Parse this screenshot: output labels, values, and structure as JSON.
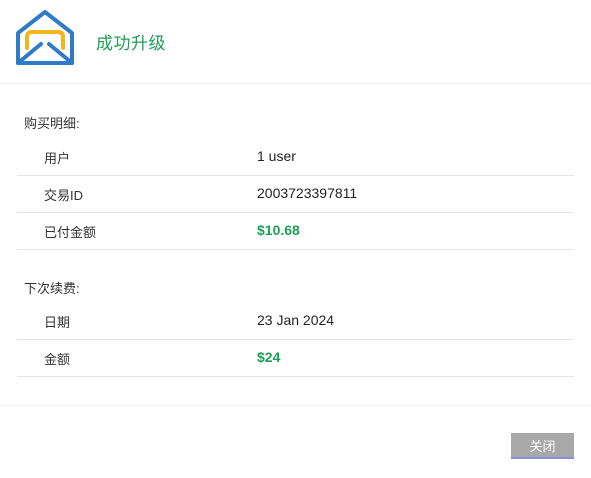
{
  "header": {
    "title": "成功升级",
    "logo_icon": "envelope-open-icon",
    "brand_color_blue": "#2f7bc8",
    "brand_color_yellow": "#f2b51c"
  },
  "purchase": {
    "section_label": "购买明细:",
    "rows": [
      {
        "label": "用户",
        "value": "1 user"
      },
      {
        "label": "交易ID",
        "value": "2003723397811"
      },
      {
        "label": "已付金额",
        "value": "$10.68"
      }
    ]
  },
  "renewal": {
    "section_label": "下次续费:",
    "rows": [
      {
        "label": "日期",
        "value": "23 Jan 2024"
      },
      {
        "label": "金额",
        "value": "$24"
      }
    ]
  },
  "footer": {
    "close_label": "关闭"
  },
  "colors": {
    "accent_green": "#1f9e57",
    "button_gray": "#a8a8a8"
  }
}
